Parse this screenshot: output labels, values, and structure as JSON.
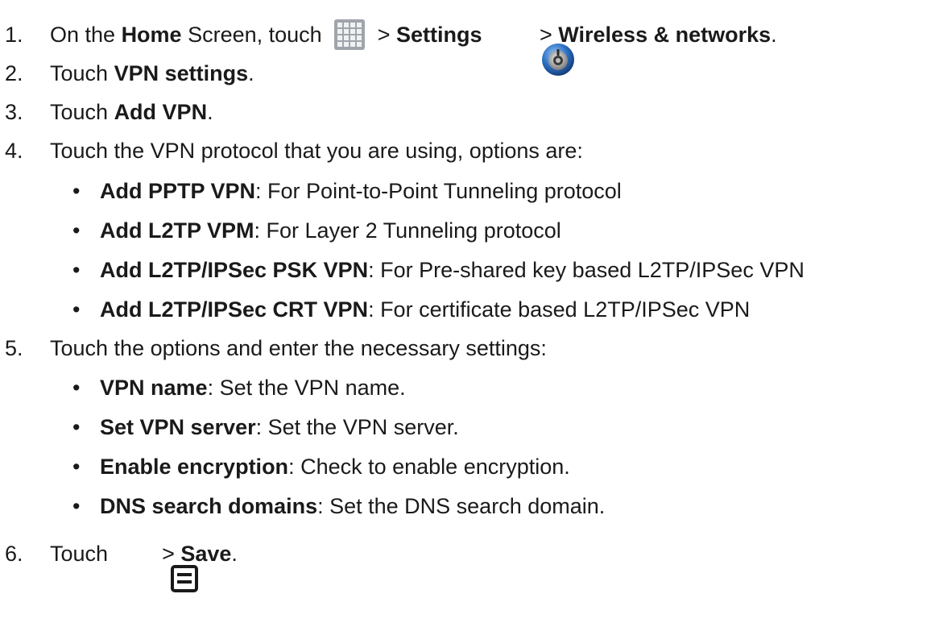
{
  "steps": [
    {
      "number": "1.",
      "parts": {
        "a": "On the ",
        "b": "Home",
        "c": " Screen, touch ",
        "d": " > ",
        "e": "Settings",
        "f": " > ",
        "g": "Wireless & networks",
        "h": "."
      }
    },
    {
      "number": "2.",
      "parts": {
        "a": "Touch ",
        "b": "VPN settings",
        "c": "."
      }
    },
    {
      "number": "3.",
      "parts": {
        "a": "Touch ",
        "b": "Add VPN",
        "c": "."
      }
    },
    {
      "number": "4.",
      "text": "Touch the VPN protocol that you are using, options are:",
      "bullets": [
        {
          "bold": "Add PPTP VPN",
          "rest": ": For Point-to-Point Tunneling protocol"
        },
        {
          "bold": "Add L2TP VPM",
          "rest": ": For Layer 2 Tunneling protocol"
        },
        {
          "bold": "Add L2TP/IPSec PSK VPN",
          "rest": ": For Pre-shared key based L2TP/IPSec VPN"
        },
        {
          "bold": "Add L2TP/IPSec CRT VPN",
          "rest": ": For certificate based L2TP/IPSec VPN"
        }
      ]
    },
    {
      "number": "5.",
      "text": "Touch the options and enter the necessary settings:",
      "bullets": [
        {
          "bold": "VPN name",
          "rest": ": Set the VPN name."
        },
        {
          "bold": "Set VPN server",
          "rest": ": Set the VPN server."
        },
        {
          "bold": "Enable encryption",
          "rest": ": Check to enable encryption."
        },
        {
          "bold": "DNS search domains",
          "rest": ": Set the DNS search domain."
        }
      ]
    },
    {
      "number": "6.",
      "parts": {
        "a": "Touch ",
        "b": " > ",
        "c": "Save",
        "d": "."
      }
    }
  ],
  "bullet_symbol": "•",
  "icons": {
    "apps": "apps-grid-icon",
    "settings": "settings-icon",
    "menu": "menu-icon"
  },
  "colors": {
    "text": "#1a1a1a",
    "apps_icon_bg": "#9fa5ab",
    "settings_icon_ring": "#2b6fc2"
  }
}
